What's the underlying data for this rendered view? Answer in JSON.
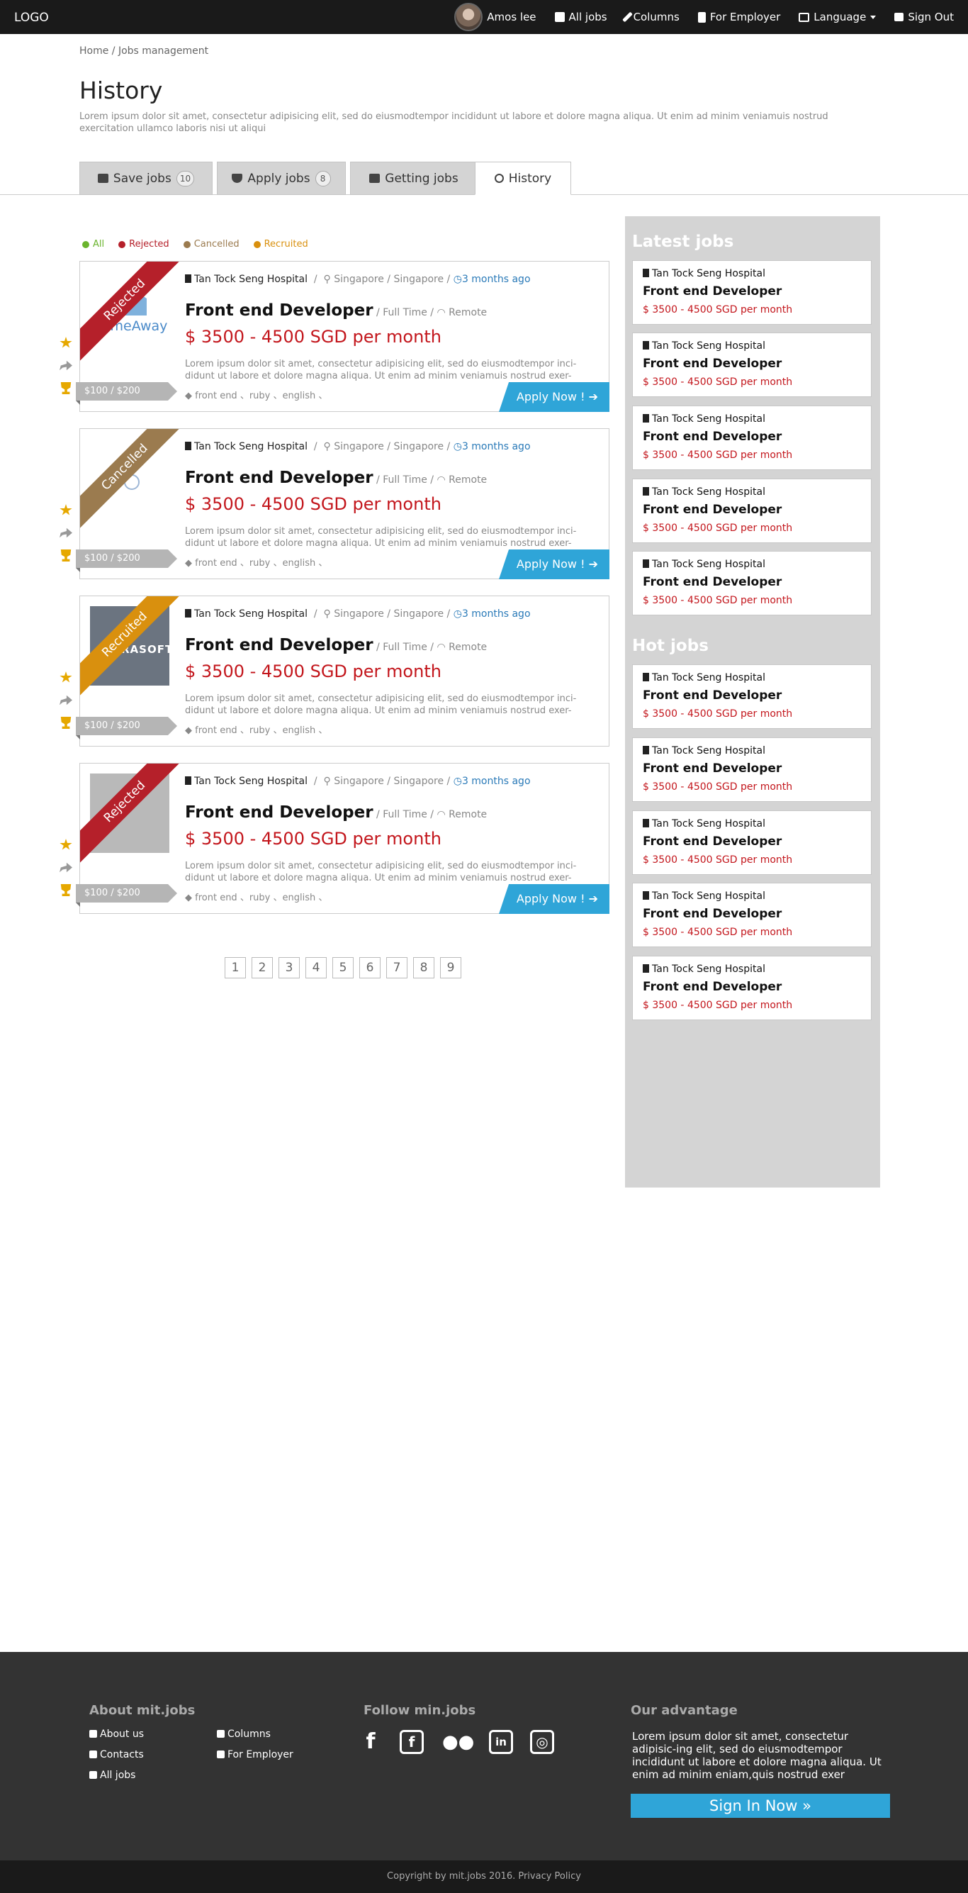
{
  "header": {
    "logo": "LOGO",
    "user": "Amos lee",
    "nav": [
      "All jobs",
      "Columns",
      "For Employer",
      "Language",
      "Sign Out"
    ]
  },
  "breadcrumb": "Home / Jobs management",
  "page": {
    "title": "History",
    "description": "Lorem ipsum dolor sit amet, consectetur adipisicing elit, sed do eiusmodtempor incididunt ut labore et dolore magna aliqua. Ut enim ad minim veniamuis nostrud exercitation ullamco laboris nisi ut aliqui"
  },
  "tabs": [
    {
      "label": "Save jobs",
      "badge": "10"
    },
    {
      "label": "Apply jobs",
      "badge": "8"
    },
    {
      "label": "Getting jobs",
      "badge": ""
    },
    {
      "label": "History",
      "badge": ""
    }
  ],
  "filters": [
    {
      "label": "All",
      "color": "#6ab42d"
    },
    {
      "label": "Rejected",
      "color": "#b5202a"
    },
    {
      "label": "Cancelled",
      "color": "#9b7b4f"
    },
    {
      "label": "Recruited",
      "color": "#d9900e"
    }
  ],
  "colors": {
    "rejected": "#b5202a",
    "cancelled": "#9b7b4f",
    "recruited": "#d9900e",
    "accent": "#2fa5d8",
    "salary": "#c3161c"
  },
  "jobs": [
    {
      "status": "Rejected",
      "logo_text": "HomeAway",
      "company": "Tan Tock Seng Hospital",
      "location": "Singapore / Singapore /",
      "time": "3 months ago",
      "title": "Front end Developer",
      "type": "/ Full Time /",
      "remote": "Remote",
      "salary": "$ 3500 - 4500  SGD per month",
      "desc": "Lorem ipsum dolor sit amet, consectetur adipisicing elit, sed do eiusmodtempor inci-didunt ut labore et dolore magna aliqua. Ut enim ad minim veniamuis nostrud exer-",
      "tags": "front end 、ruby 、english 、",
      "range": "$100 / $200",
      "apply": "Apply Now !"
    },
    {
      "status": "Cancelled",
      "logo_text": "",
      "company": "Tan Tock Seng Hospital",
      "location": "Singapore / Singapore /",
      "time": "3 months ago",
      "title": "Front end Developer",
      "type": "/ Full Time /",
      "remote": "Remote",
      "salary": "$ 3500 - 4500  SGD per month",
      "desc": "Lorem ipsum dolor sit amet, consectetur adipisicing elit, sed do eiusmodtempor inci-didunt ut labore et dolore magna aliqua. Ut enim ad minim veniamuis nostrud exer-",
      "tags": "front end 、ruby 、english 、",
      "range": "$100 / $200",
      "apply": "Apply Now !"
    },
    {
      "status": "Recruited",
      "logo_text": "RASOFT",
      "company": "Tan Tock Seng Hospital",
      "location": "Singapore / Singapore /",
      "time": "3 months ago",
      "title": "Front end Developer",
      "type": "/ Full Time /",
      "remote": "Remote",
      "salary": "$ 3500 - 4500  SGD per month",
      "desc": "Lorem ipsum dolor sit amet, consectetur adipisicing elit, sed do eiusmodtempor inci-didunt ut labore et dolore magna aliqua. Ut enim ad minim veniamuis nostrud exer-",
      "tags": "front end 、ruby 、english 、",
      "range": "$100 / $200",
      "apply": ""
    },
    {
      "status": "Rejected",
      "logo_text": "",
      "company": "Tan Tock Seng Hospital",
      "location": "Singapore / Singapore /",
      "time": "3 months ago",
      "title": "Front end Developer",
      "type": "/ Full Time /",
      "remote": "Remote",
      "salary": "$ 3500 - 4500  SGD per month",
      "desc": "Lorem ipsum dolor sit amet, consectetur adipisicing elit, sed do eiusmodtempor inci-didunt ut labore et dolore magna aliqua. Ut enim ad minim veniamuis nostrud exer-",
      "tags": "front end 、ruby 、english 、",
      "range": "$100 / $200",
      "apply": "Apply Now !"
    }
  ],
  "pagination": [
    "1",
    "2",
    "3",
    "4",
    "5",
    "6",
    "7",
    "8",
    "9"
  ],
  "sidebar": {
    "latest_heading": "Latest jobs",
    "hot_heading": "Hot jobs",
    "latest": [
      {
        "company": "Tan Tock Seng Hospital",
        "title": "Front end Developer",
        "salary": "$ 3500 - 4500 SGD per month"
      },
      {
        "company": "Tan Tock Seng Hospital",
        "title": "Front end Developer",
        "salary": "$ 3500 - 4500 SGD per month"
      },
      {
        "company": "Tan Tock Seng Hospital",
        "title": "Front end Developer",
        "salary": "$ 3500 - 4500 SGD per month"
      },
      {
        "company": "Tan Tock Seng Hospital",
        "title": "Front end Developer",
        "salary": "$ 3500 - 4500 SGD per month"
      },
      {
        "company": "Tan Tock Seng Hospital",
        "title": "Front end Developer",
        "salary": "$ 3500 - 4500 SGD per month"
      }
    ],
    "hot": [
      {
        "company": "Tan Tock Seng Hospital",
        "title": "Front end Developer",
        "salary": "$ 3500 - 4500 SGD per month"
      },
      {
        "company": "Tan Tock Seng Hospital",
        "title": "Front end Developer",
        "salary": "$ 3500 - 4500 SGD per month"
      },
      {
        "company": "Tan Tock Seng Hospital",
        "title": "Front end Developer",
        "salary": "$ 3500 - 4500 SGD per month"
      },
      {
        "company": "Tan Tock Seng Hospital",
        "title": "Front end Developer",
        "salary": "$ 3500 - 4500 SGD per month"
      },
      {
        "company": "Tan Tock Seng Hospital",
        "title": "Front end Developer",
        "salary": "$ 3500 - 4500 SGD per month"
      }
    ]
  },
  "footer": {
    "about_heading": "About mit.jobs",
    "about_links": [
      "About us",
      "Columns",
      "Contacts",
      "For Employer",
      "All jobs"
    ],
    "follow_heading": "Follow min.jobs",
    "social": [
      "facebook-icon",
      "facebook-square-icon",
      "wechat-icon",
      "linkedin-icon",
      "instagram-icon"
    ],
    "advantage_heading": "Our advantage",
    "advantage_text": "Lorem ipsum dolor sit amet, consectetur adipisic-ing elit, sed do eiusmodtempor incididunt ut labore et dolore magna aliqua. Ut enim ad minim eniam,quis nostrud exer",
    "signin": "Sign In Now",
    "copyright": "Copyright by mit.jobs 2016. Privacy Policy"
  }
}
